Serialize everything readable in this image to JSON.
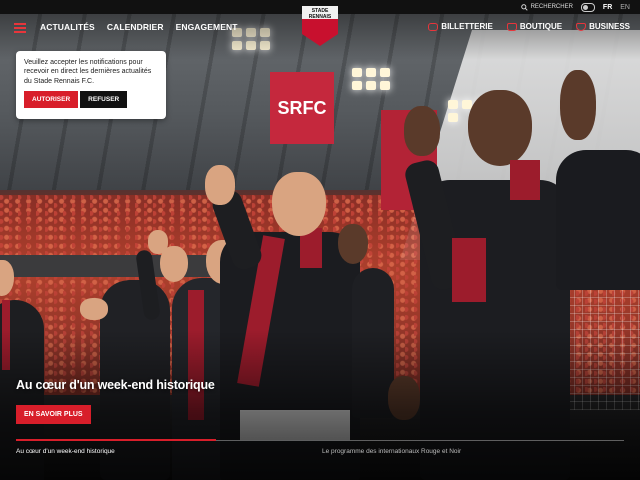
{
  "topbar": {
    "search_label": "RECHERCHER",
    "lang_active": "FR",
    "lang_other": "EN"
  },
  "nav": {
    "items": [
      {
        "label": "ACTUALITÉS"
      },
      {
        "label": "CALENDRIER"
      },
      {
        "label": "ENGAGEMENT"
      }
    ],
    "right": [
      {
        "label": "BILLETTERIE",
        "icon": "ticket-icon"
      },
      {
        "label": "BOUTIQUE",
        "icon": "shopping-bag-icon"
      },
      {
        "label": "BUSINESS",
        "icon": "shield-icon"
      }
    ]
  },
  "logo": {
    "line1": "STADE",
    "line2": "RENNAIS"
  },
  "banner": {
    "text": "SRFC"
  },
  "notification": {
    "message": "Veuillez accepter les notifications pour recevoir en direct les dernières actualités du Stade Rennais F.C.",
    "allow_label": "AUTORISER",
    "refuse_label": "REFUSER"
  },
  "hero": {
    "title": "Au cœur d'un week-end historique",
    "cta_label": "EN SAVOIR PLUS"
  },
  "slider": {
    "items": [
      "Au cœur d'un week-end historique",
      "Le programme des internationaux Rouge et Noir"
    ]
  },
  "colors": {
    "accent": "#d81e2a",
    "dark": "#111111"
  }
}
